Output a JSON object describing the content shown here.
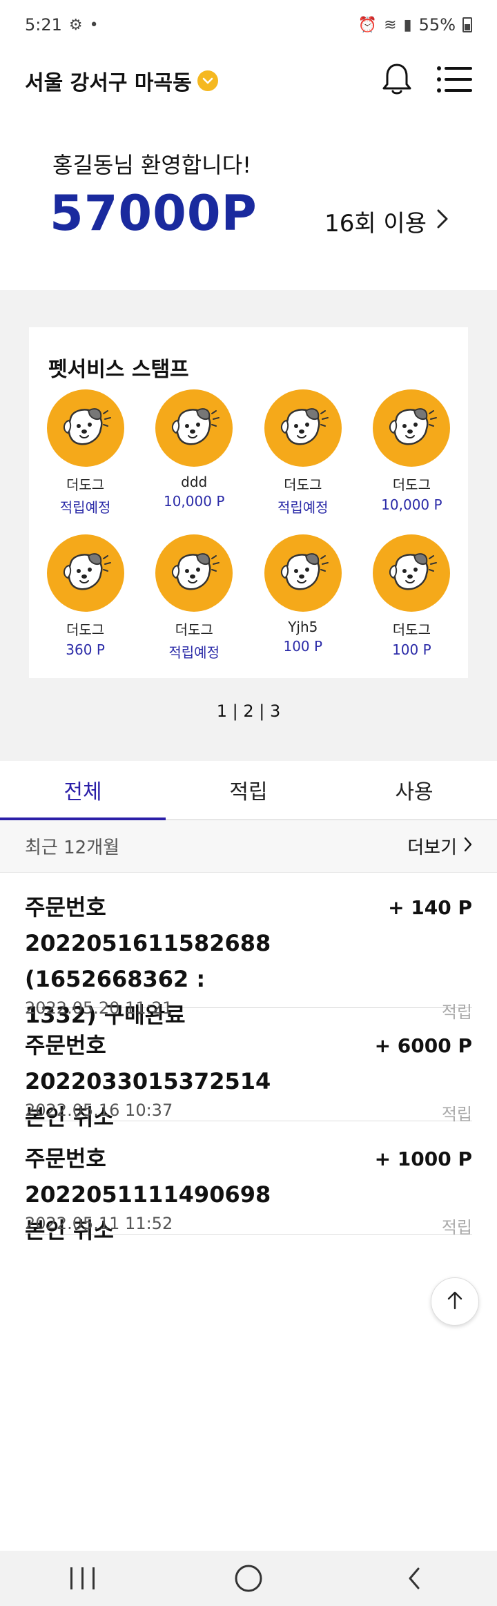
{
  "status": {
    "time": "5:21",
    "battery": "55%"
  },
  "header": {
    "location": "서울 강서구 마곡동"
  },
  "greeting": {
    "welcome": "홍길동님 환영합니다!",
    "points": "57000P",
    "usage": "16회 이용"
  },
  "stamps": {
    "title": "펫서비스 스탬프",
    "items": [
      {
        "name": "더도그",
        "sub": "적립예정"
      },
      {
        "name": "ddd",
        "sub": "10,000 P"
      },
      {
        "name": "더도그",
        "sub": "적립예정"
      },
      {
        "name": "더도그",
        "sub": "10,000 P"
      },
      {
        "name": "더도그",
        "sub": "360 P"
      },
      {
        "name": "더도그",
        "sub": "적립예정"
      },
      {
        "name": "Yjh5",
        "sub": "100 P"
      },
      {
        "name": "더도그",
        "sub": "100 P"
      }
    ],
    "pager": "1 | 2 | 3"
  },
  "tabs": [
    {
      "label": "전체",
      "active": true
    },
    {
      "label": "적립",
      "active": false
    },
    {
      "label": "사용",
      "active": false
    }
  ],
  "filter": {
    "period": "최근 12개월",
    "more": "더보기"
  },
  "history": [
    {
      "title": "주문번호 2022051611582688 (1652668362 : 1332) 구매완료",
      "amount": "+ 140 P",
      "date": "2022.05.20 11:21",
      "type": "적립"
    },
    {
      "title": "주문번호 2022033015372514 본인 취소",
      "amount": "+ 6000 P",
      "date": "2022.05.16 10:37",
      "type": "적립"
    },
    {
      "title": "주문번호 2022051111490698 본인 취소",
      "amount": "+ 1000 P",
      "date": "2022.05.11 11:52",
      "type": "적립"
    }
  ],
  "colors": {
    "accent": "#2b1fa8",
    "points": "#1a2a9e",
    "stamp": "#f5a91a"
  }
}
